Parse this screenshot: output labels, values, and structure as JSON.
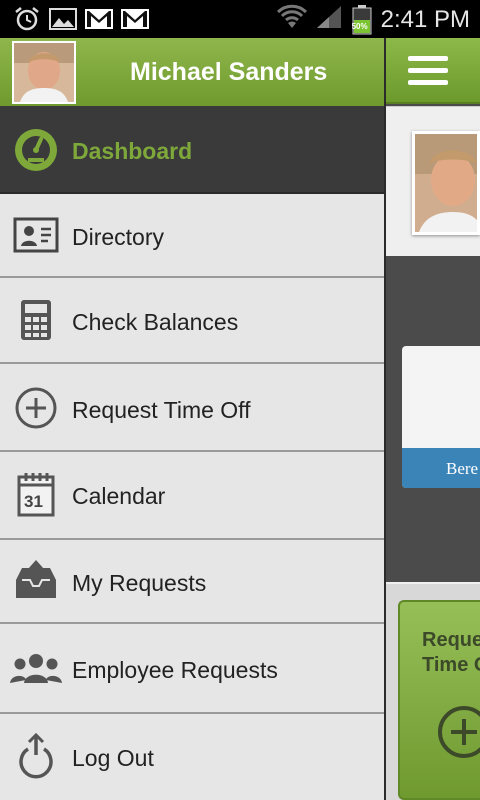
{
  "status_bar": {
    "time": "2:41 PM",
    "battery": "50%",
    "icons": [
      "alarm-icon",
      "image-icon",
      "gmail-icon",
      "gmail-icon",
      "wifi-icon",
      "signal-icon",
      "battery-icon"
    ]
  },
  "drawer": {
    "user_name": "Michael Sanders",
    "items": [
      {
        "label": "Dashboard",
        "icon": "gauge-icon",
        "active": true
      },
      {
        "label": "Directory",
        "icon": "contact-card-icon"
      },
      {
        "label": "Check Balances",
        "icon": "calculator-icon"
      },
      {
        "label": "Request Time Off",
        "icon": "plus-circle-icon"
      },
      {
        "label": "Calendar",
        "icon": "calendar-icon",
        "calendar_day": "31"
      },
      {
        "label": "My Requests",
        "icon": "inbox-upload-icon"
      },
      {
        "label": "Employee Requests",
        "icon": "people-icon"
      },
      {
        "label": "Log Out",
        "icon": "power-icon"
      }
    ]
  },
  "main": {
    "card_caption_partial": "Bere",
    "tile_label_lines": [
      "Reque",
      "Time O"
    ]
  },
  "colors": {
    "accent_green": "#7ea83a",
    "header_green": "#8fb64c",
    "active_row": "#3a3a3a",
    "stripe_blue": "#3a84b8"
  }
}
